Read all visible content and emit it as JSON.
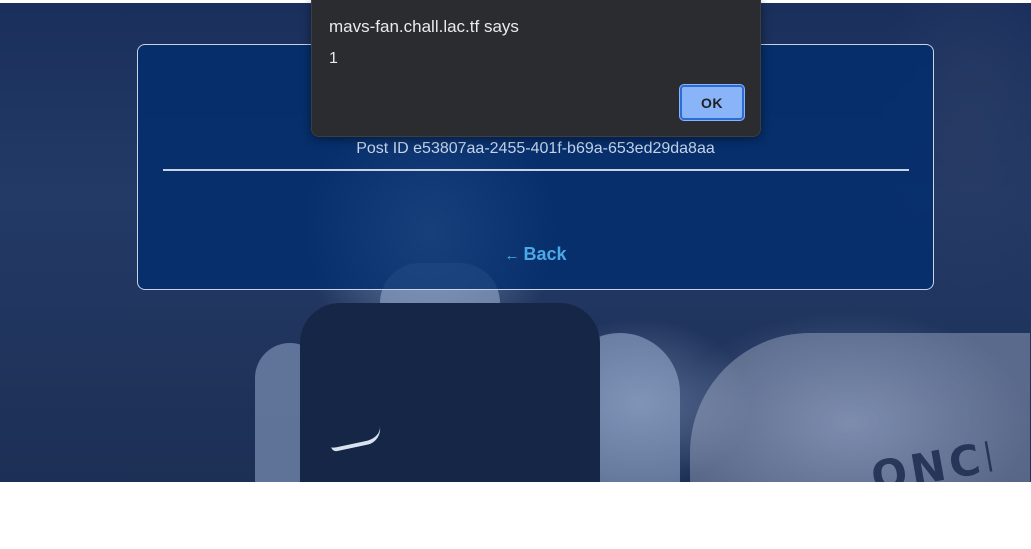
{
  "card": {
    "post_id_text": "Post ID e53807aa-2455-401f-b69a-653ed29da8aa",
    "back_arrow": "←",
    "back_label": "Back",
    "link_color": "#4da8e6"
  },
  "alert": {
    "title": "mavs-fan.chall.lac.tf says",
    "message": "1",
    "ok_label": "OK",
    "button_color": "#8ab4f8"
  },
  "background": {
    "jersey_lettering": "ONCIC"
  }
}
